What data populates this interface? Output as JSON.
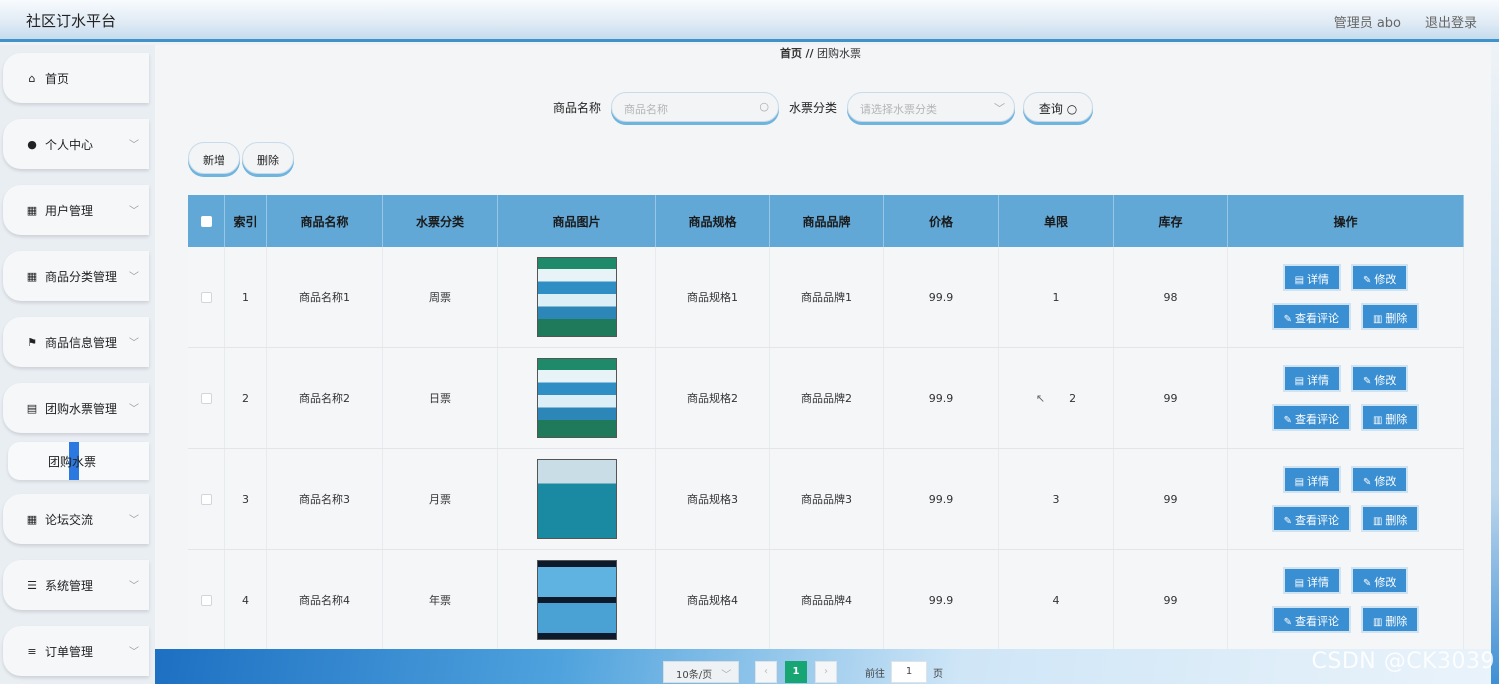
{
  "header": {
    "app_title": "社区订水平台",
    "admin_label": "管理员 abo",
    "logout_label": "退出登录"
  },
  "sidebar": {
    "items": [
      {
        "label": "首页",
        "icon": "home-icon",
        "glyph": "⌂"
      },
      {
        "label": "个人中心",
        "icon": "user-icon",
        "glyph": "●"
      },
      {
        "label": "用户管理",
        "icon": "grid-icon",
        "glyph": "▦"
      },
      {
        "label": "商品分类管理",
        "icon": "grid-icon",
        "glyph": "▦"
      },
      {
        "label": "商品信息管理",
        "icon": "flag-icon",
        "glyph": "⚑"
      },
      {
        "label": "团购水票管理",
        "icon": "document-icon",
        "glyph": "▤"
      },
      {
        "label": "论坛交流",
        "icon": "grid-icon",
        "glyph": "▦"
      },
      {
        "label": "系统管理",
        "icon": "sliders-icon",
        "glyph": "☰"
      },
      {
        "label": "订单管理",
        "icon": "list-icon",
        "glyph": "≡"
      }
    ],
    "submenu_label": "团购水票"
  },
  "breadcrumb": {
    "home": "首页",
    "separator": "//",
    "current": "团购水票"
  },
  "search": {
    "name_label": "商品名称",
    "name_placeholder": "商品名称",
    "category_label": "水票分类",
    "category_placeholder": "请选择水票分类",
    "query_label": "查询"
  },
  "actions": {
    "add": "新增",
    "delete": "删除"
  },
  "table": {
    "headers": [
      "索引",
      "商品名称",
      "水票分类",
      "商品图片",
      "商品规格",
      "商品品牌",
      "价格",
      "单限",
      "库存",
      "操作"
    ],
    "rows": [
      {
        "index": "1",
        "name": "商品名称1",
        "category": "周票",
        "spec": "商品规格1",
        "brand": "商品品牌1",
        "price": "99.9",
        "limit": "1",
        "stock": "98"
      },
      {
        "index": "2",
        "name": "商品名称2",
        "category": "日票",
        "spec": "商品规格2",
        "brand": "商品品牌2",
        "price": "99.9",
        "limit": "2",
        "stock": "99"
      },
      {
        "index": "3",
        "name": "商品名称3",
        "category": "月票",
        "spec": "商品规格3",
        "brand": "商品品牌3",
        "price": "99.9",
        "limit": "3",
        "stock": "99"
      },
      {
        "index": "4",
        "name": "商品名称4",
        "category": "年票",
        "spec": "商品规格4",
        "brand": "商品品牌4",
        "price": "99.9",
        "limit": "4",
        "stock": "99"
      }
    ],
    "ops": {
      "detail": "详情",
      "edit": "修改",
      "comments": "查看评论",
      "delete": "删除"
    }
  },
  "pager": {
    "page_size": "10条/页",
    "current_page": "1",
    "goto_label": "前往",
    "goto_value": "1",
    "page_unit": "页"
  },
  "watermark": "CSDN @CK3039"
}
